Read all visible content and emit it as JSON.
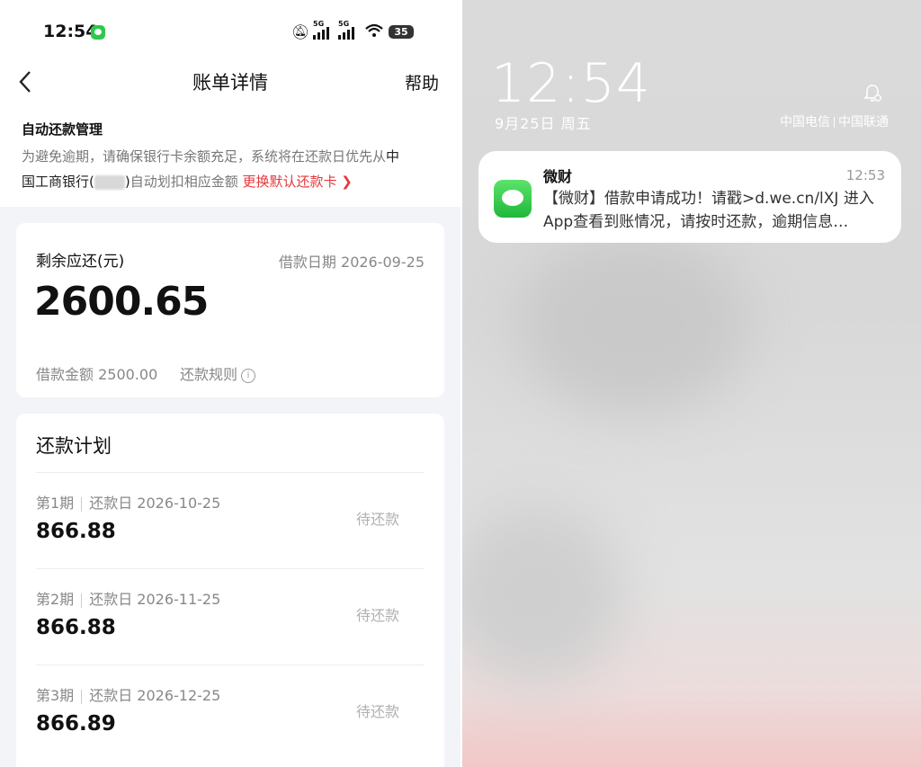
{
  "left": {
    "status_bar": {
      "time": "12:54",
      "battery": "35",
      "network1": "5G",
      "network2": "5G"
    },
    "header": {
      "title": "账单详情",
      "help": "帮助"
    },
    "auto_repay": {
      "title": "自动还款管理",
      "desc_part1": "为避免逾期，请确保银行卡余额充足，系统将在还款日优先从",
      "desc_bank_a": "中",
      "desc_bank_b": "国工商银行(",
      "desc_bank_c": ")",
      "desc_part2": "自动划扣相应金额",
      "change_card": "更换默认还款卡 ❯"
    },
    "summary": {
      "remaining_label": "剩余应还(元)",
      "loan_date": "借款日期 2026-09-25",
      "remaining_amount": "2600.65",
      "principal": "借款金额 2500.00",
      "rules": "还款规则"
    },
    "plan": {
      "title": "还款计划",
      "items": [
        {
          "period": "第1期",
          "due": "还款日 2026-10-25",
          "amount": "866.88",
          "status": "待还款"
        },
        {
          "period": "第2期",
          "due": "还款日 2026-11-25",
          "amount": "866.88",
          "status": "待还款"
        },
        {
          "period": "第3期",
          "due": "还款日 2026-12-25",
          "amount": "866.89",
          "status": "待还款"
        }
      ]
    }
  },
  "right": {
    "lock_time": "12:54",
    "lock_date": "9月25日 周五",
    "carrier1": "中国电信",
    "carrier2": "中国联通",
    "notification": {
      "sender": "微财",
      "time": "12:53",
      "line1": "【微财】借款申请成功！请戳>d.we.cn/lXJ 进入",
      "line2": "App查看到账情况，请按时还款，逾期信息…"
    }
  },
  "colors": {
    "accent_red": "#e4393c",
    "sms_green": "#2dc84d"
  }
}
